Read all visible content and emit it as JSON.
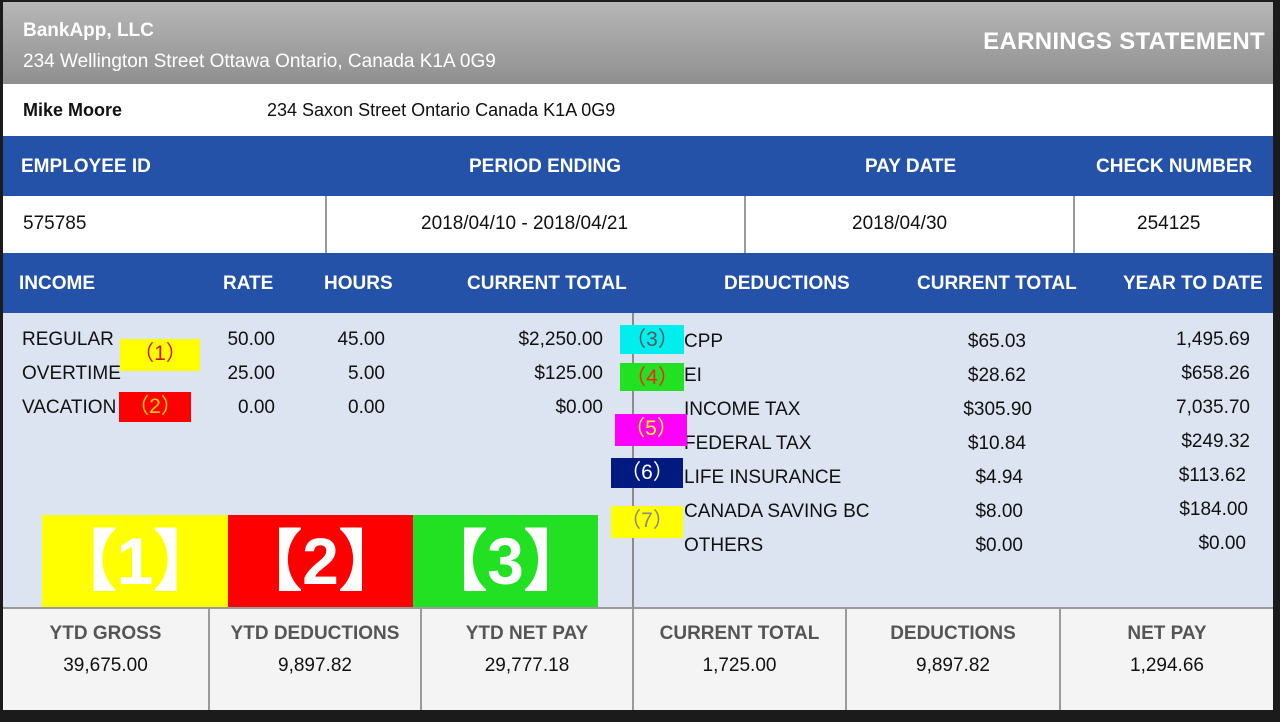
{
  "company": {
    "name": "BankApp, LLC",
    "address": "234 Wellington Street Ottawa Ontario, Canada K1A 0G9"
  },
  "document_title": "EARNINGS STATEMENT",
  "employee": {
    "name": "Mike Moore",
    "address": "234 Saxon Street Ontario Canada K1A 0G9"
  },
  "id_headers": {
    "employee_id": "EMPLOYEE ID",
    "period_ending": "PERIOD ENDING",
    "pay_date": "PAY DATE",
    "check_number": "CHECK NUMBER"
  },
  "id_values": {
    "employee_id": "575785",
    "period_ending": "2018/04/10 - 2018/04/21",
    "pay_date": "2018/04/30",
    "check_number": "254125"
  },
  "detail_headers": {
    "income": "INCOME",
    "rate": "RATE",
    "hours": "HOURS",
    "current_total": "CURRENT TOTAL",
    "deductions": "DEDUCTIONS",
    "deductions_current_total": "CURRENT TOTAL",
    "year_to_date": "YEAR TO DATE"
  },
  "income_rows": [
    {
      "label": "REGULAR",
      "rate": "50.00",
      "hours": "45.00",
      "total": "$2,250.00"
    },
    {
      "label": "OVERTIME",
      "rate": "25.00",
      "hours": "5.00",
      "total": "$125.00"
    },
    {
      "label": "VACATION",
      "rate": "0.00",
      "hours": "0.00",
      "total": "$0.00"
    }
  ],
  "deduction_rows": [
    {
      "label": "CPP",
      "current": "$65.03",
      "ytd": "1,495.69"
    },
    {
      "label": "EI",
      "current": "$28.62",
      "ytd": "$658.26"
    },
    {
      "label": "INCOME TAX",
      "current": "$305.90",
      "ytd": "7,035.70"
    },
    {
      "label": "FEDERAL TAX",
      "current": "$10.84",
      "ytd": "$249.32"
    },
    {
      "label": "LIFE INSURANCE",
      "current": "$4.94",
      "ytd": "$113.62"
    },
    {
      "label": "CANADA SAVING BC",
      "current": "$8.00",
      "ytd": "$184.00"
    },
    {
      "label": "OTHERS",
      "current": "$0.00",
      "ytd": "$0.00"
    }
  ],
  "small_markers": [
    {
      "text": "（1）",
      "bg": "#ffff00",
      "color": "#d01818"
    },
    {
      "text": "（2）",
      "bg": "#ff0000",
      "color": "#ffd000"
    },
    {
      "text": "（3）",
      "bg": "#00eeee",
      "color": "#5a5a5a"
    },
    {
      "text": "（4）",
      "bg": "#22e022",
      "color": "#ff2020"
    },
    {
      "text": "（5）",
      "bg": "#ff00ff",
      "color": "#ffff00"
    },
    {
      "text": "（6）",
      "bg": "#001a80",
      "color": "#ffffff"
    },
    {
      "text": "（7）",
      "bg": "#ffff00",
      "color": "#888888"
    }
  ],
  "big_markers": [
    {
      "text": "【1】",
      "bg": "#ffff00"
    },
    {
      "text": "【2】",
      "bg": "#ff0000"
    },
    {
      "text": "【3】",
      "bg": "#22e022"
    }
  ],
  "summary": [
    {
      "label": "YTD GROSS",
      "value": "39,675.00"
    },
    {
      "label": "YTD DEDUCTIONS",
      "value": "9,897.82"
    },
    {
      "label": "YTD NET PAY",
      "value": "29,777.18"
    },
    {
      "label": "CURRENT TOTAL",
      "value": "1,725.00"
    },
    {
      "label": "DEDUCTIONS",
      "value": "9,897.82"
    },
    {
      "label": "NET PAY",
      "value": "1,294.66"
    }
  ],
  "colors": {
    "header_blue": "#2452a8",
    "body_bg": "#dbe4f0",
    "title_bar_gray": "#a3a3a3"
  }
}
